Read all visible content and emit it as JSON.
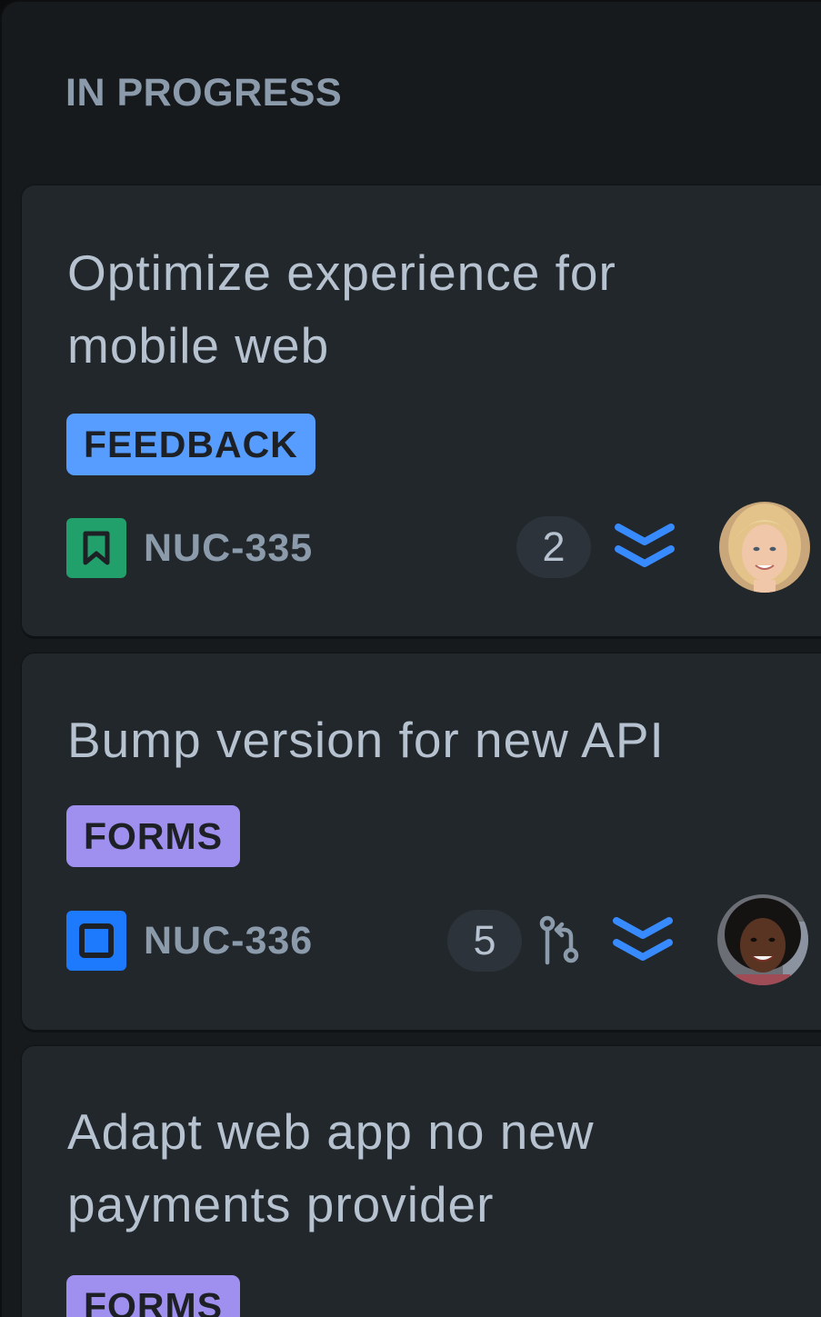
{
  "column": {
    "title": "IN PROGRESS"
  },
  "cards": [
    {
      "title": "Optimize experience for mobile web",
      "tag": "FEEDBACK",
      "tag_color": "#579dff",
      "issue_type": "story-icon",
      "issue_type_color": "#22a06b",
      "key": "NUC-335",
      "comment_count": "2",
      "priority": "lowest-priority-icon",
      "priority_color": "#388bff",
      "assignee": "avatar-blonde-woman"
    },
    {
      "title": "Bump version for new API",
      "tag": "FORMS",
      "tag_color": "#9f8fef",
      "issue_type": "task-icon",
      "issue_type_color": "#1d7afc",
      "key": "NUC-336",
      "comment_count": "5",
      "branch": "pull-request-icon",
      "priority": "lowest-priority-icon",
      "priority_color": "#388bff",
      "assignee": "avatar-dark-haired-woman"
    },
    {
      "title": "Adapt web app no new payments provider",
      "tag": "FORMS",
      "tag_color": "#9f8fef"
    }
  ]
}
